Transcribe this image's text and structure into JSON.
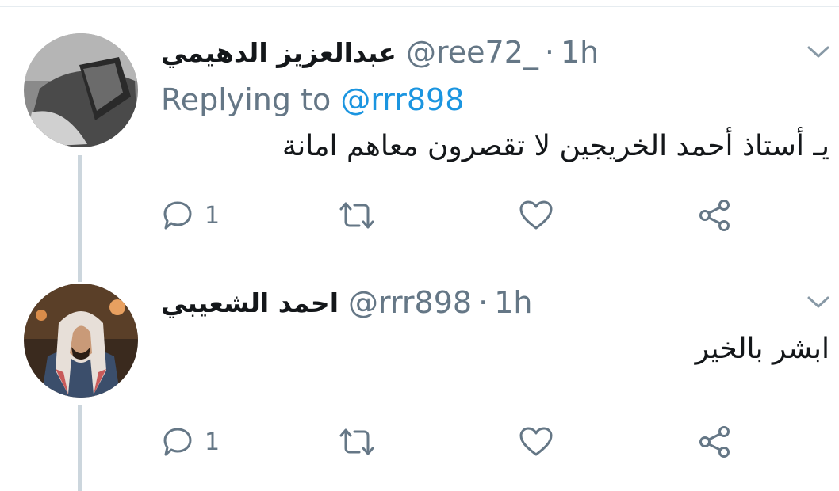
{
  "colors": {
    "text": "#14171a",
    "muted": "#657786",
    "link": "#1b95e0",
    "thread_line": "#ccd6dd",
    "divider": "#e6ecf0",
    "background": "#ffffff"
  },
  "tweets": [
    {
      "display_name": "عبدالعزيز الدهيمي",
      "handle": "@ree72_",
      "separator": "·",
      "time": "1h",
      "replying_prefix": "Replying to",
      "replying_to": "@rrr898",
      "text": "يـ أستاذ أحمد الخريجين لا تقصرون معاهم امانة",
      "reply_count": "1",
      "icons": [
        "chevron-down-icon",
        "reply-icon",
        "retweet-icon",
        "like-icon",
        "share-icon"
      ]
    },
    {
      "display_name": "احمد الشعيبي",
      "handle": "@rrr898",
      "separator": "·",
      "time": "1h",
      "text": "ابشر بالخير",
      "reply_count": "1",
      "icons": [
        "chevron-down-icon",
        "reply-icon",
        "retweet-icon",
        "like-icon",
        "share-icon"
      ]
    }
  ]
}
